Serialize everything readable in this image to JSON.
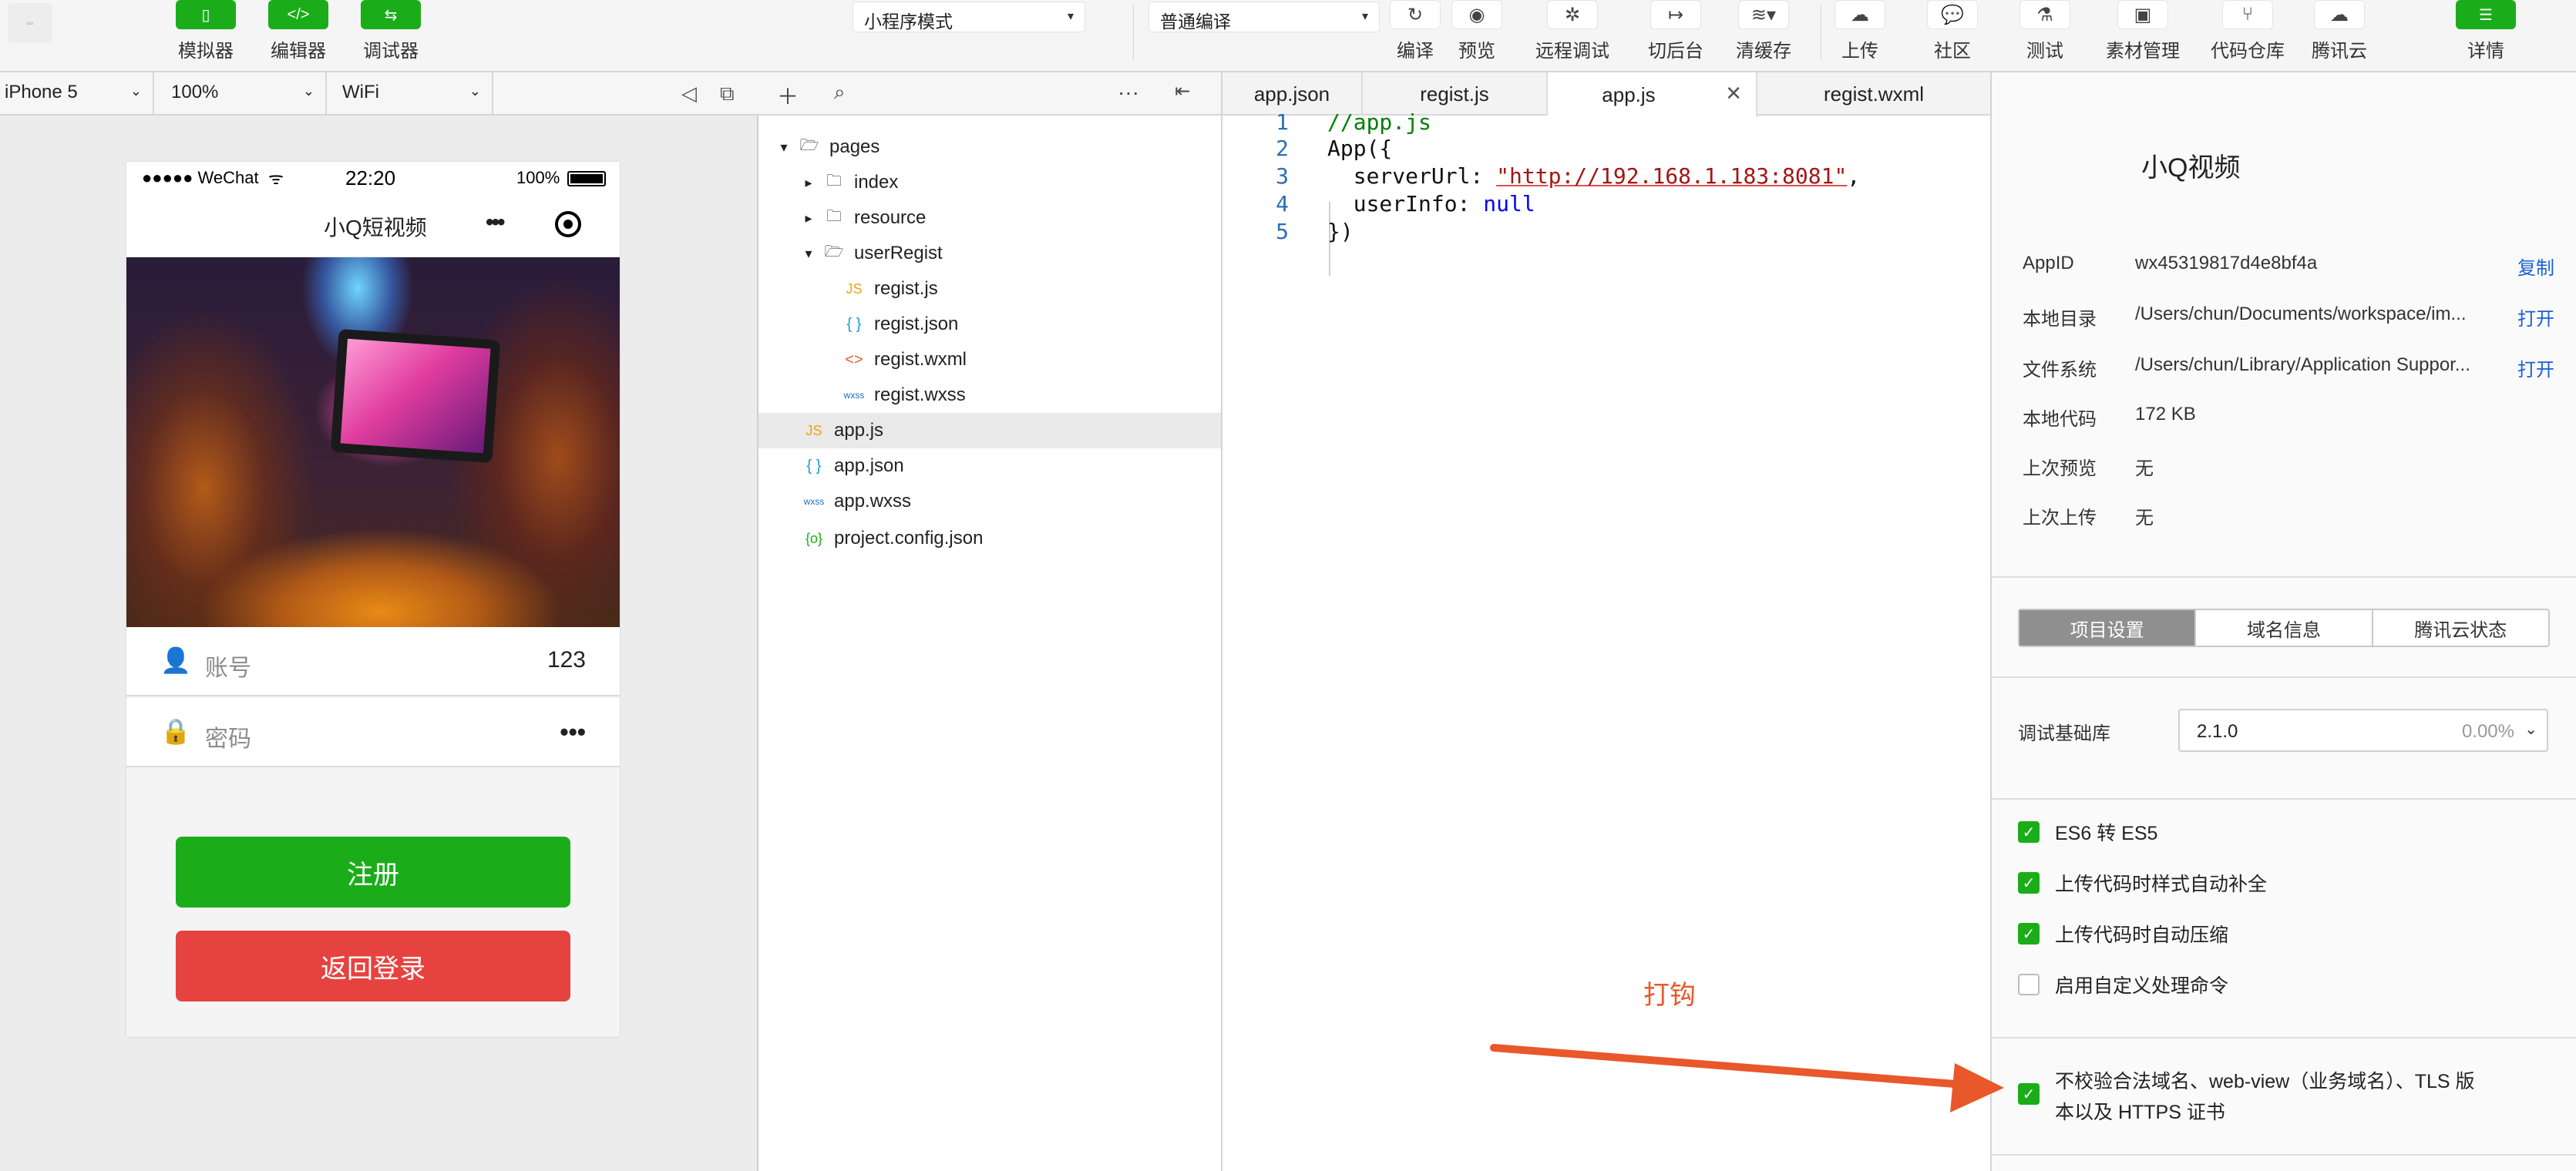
{
  "toolbar": {
    "simulator": "模拟器",
    "editor": "编辑器",
    "debugger": "调试器",
    "mode_select": "小程序模式",
    "compile_select": "普通编译",
    "compile": "编译",
    "preview": "预览",
    "remote_debug": "远程调试",
    "background": "切后台",
    "clear_cache": "清缓存",
    "upload": "上传",
    "community": "社区",
    "test": "测试",
    "assets": "素材管理",
    "repo": "代码仓库",
    "tencent_cloud": "腾讯云",
    "details": "详情"
  },
  "sim_bar": {
    "device": "iPhone 5",
    "zoom": "100%",
    "network": "WiFi"
  },
  "phone": {
    "status": {
      "carrier": "●●●●● WeChat",
      "time": "22:20",
      "battery": "100%"
    },
    "nav_title": "小Q短视频",
    "account_label": "账号",
    "account_value": "123",
    "password_label": "密码",
    "password_value": "•••",
    "register_btn": "注册",
    "back_btn": "返回登录"
  },
  "tree": {
    "items": [
      {
        "name": "pages",
        "type": "folder-open"
      },
      {
        "name": "index",
        "type": "folder"
      },
      {
        "name": "resource",
        "type": "folder"
      },
      {
        "name": "userRegist",
        "type": "folder-open"
      },
      {
        "name": "regist.js",
        "type": "js"
      },
      {
        "name": "regist.json",
        "type": "json"
      },
      {
        "name": "regist.wxml",
        "type": "wxml"
      },
      {
        "name": "regist.wxss",
        "type": "wxss"
      },
      {
        "name": "app.js",
        "type": "js"
      },
      {
        "name": "app.json",
        "type": "json"
      },
      {
        "name": "app.wxss",
        "type": "wxss"
      },
      {
        "name": "project.config.json",
        "type": "config"
      }
    ]
  },
  "editor": {
    "tabs": [
      "app.json",
      "regist.js",
      "app.js",
      "regist.wxml"
    ],
    "active_tab": "app.js",
    "lines": [
      {
        "n": "1",
        "text": "//app.js"
      },
      {
        "n": "2",
        "text": "App({"
      },
      {
        "n": "3",
        "key": "  serverUrl: ",
        "str": "\"http://192.168.1.183:8081\"",
        "tail": ","
      },
      {
        "n": "4",
        "key": "  userInfo: ",
        "kw": "null"
      },
      {
        "n": "5",
        "text": "})"
      }
    ]
  },
  "details": {
    "title": "小Q视频",
    "rows": [
      {
        "k": "AppID",
        "v": "wx45319817d4e8bf4a",
        "a": "复制"
      },
      {
        "k": "本地目录",
        "v": "/Users/chun/Documents/workspace/im...",
        "a": "打开"
      },
      {
        "k": "文件系统",
        "v": "/Users/chun/Library/Application Suppor...",
        "a": "打开"
      },
      {
        "k": "本地代码",
        "v": "172 KB",
        "a": ""
      },
      {
        "k": "上次预览",
        "v": "无",
        "a": ""
      },
      {
        "k": "上次上传",
        "v": "无",
        "a": ""
      }
    ],
    "tabs": [
      "项目设置",
      "域名信息",
      "腾讯云状态"
    ],
    "lib_label": "调试基础库",
    "lib_version": "2.1.0",
    "lib_pct": "0.00%",
    "checks": [
      {
        "label": "ES6 转 ES5",
        "checked": true
      },
      {
        "label": "上传代码时样式自动补全",
        "checked": true
      },
      {
        "label": "上传代码时自动压缩",
        "checked": true
      },
      {
        "label": "启用自定义处理命令",
        "checked": false
      }
    ],
    "domain_check_line1": "不校验合法域名、web-view（业务域名）、TLS 版",
    "domain_check_line2": "本以及 HTTPS 证书"
  },
  "annotation": "打钩",
  "colors": {
    "green": "#1aad19",
    "red": "#e64340",
    "link": "#1a5fd8",
    "annotation": "#e8582a"
  }
}
